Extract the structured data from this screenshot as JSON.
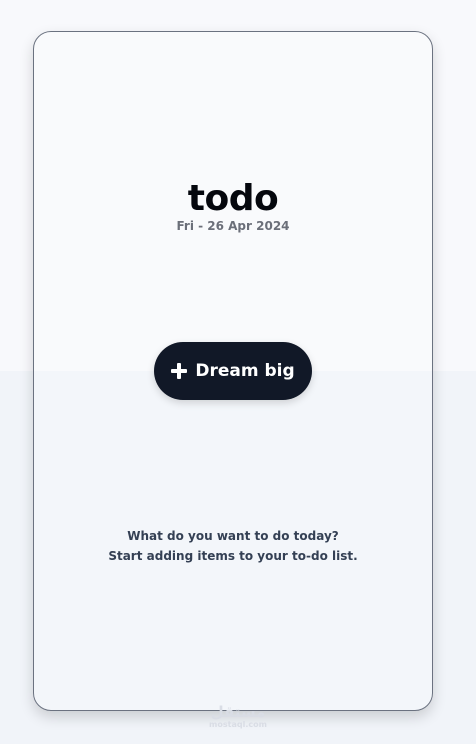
{
  "app": {
    "title": "todo",
    "date": "Fri - 26 Apr 2024"
  },
  "actions": {
    "add_label": "Dream big",
    "add_icon": "plus-icon"
  },
  "empty_state": {
    "line1": "What do you want to do today?",
    "line2": "Start adding items to your to-do list."
  },
  "watermark": {
    "arabic": "مستقل",
    "latin": "mostaql.com"
  },
  "colors": {
    "button_bg": "#111827",
    "button_text": "#ffffff",
    "title": "#05070d",
    "muted_text": "#6b6f79",
    "body_text": "#344054",
    "bg_top": "#f8f9fc",
    "bg_bottom": "#f1f4f9"
  }
}
